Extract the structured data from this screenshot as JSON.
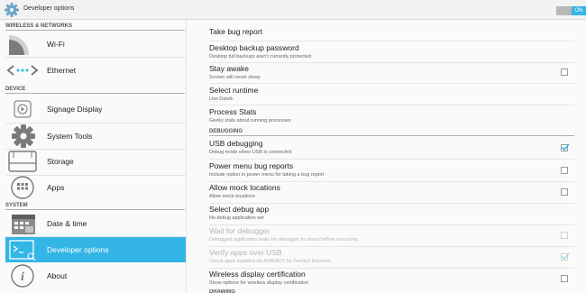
{
  "titlebar": {
    "title": "Developer options",
    "toggle_label": "ON",
    "toggle_on": true,
    "gear_icon": "gear-icon"
  },
  "sidebar": {
    "sections": [
      "WIRELESS & NETWORKS",
      "DEVICE",
      "SYSTEM"
    ],
    "items": [
      {
        "label": "Wi-Fi",
        "icon": "wifi-icon"
      },
      {
        "label": "Ethernet",
        "icon": "ethernet-icon"
      },
      {
        "label": "Signage Display",
        "icon": "signage-display-icon"
      },
      {
        "label": "System Tools",
        "icon": "gear-icon"
      },
      {
        "label": "Storage",
        "icon": "storage-icon"
      },
      {
        "label": "Apps",
        "icon": "apps-icon"
      },
      {
        "label": "Date & time",
        "icon": "calendar-icon"
      },
      {
        "label": "Developer options",
        "icon": "terminal-icon",
        "selected": true
      },
      {
        "label": "About",
        "icon": "info-icon"
      }
    ]
  },
  "main": {
    "sections": [
      "DEBUGGING",
      "DRAWING"
    ],
    "prefs": [
      {
        "title": "Take bug report",
        "summary": ""
      },
      {
        "title": "Desktop backup password",
        "summary": "Desktop full backups aren't currently protected"
      },
      {
        "title": "Stay awake",
        "summary": "Screen will never sleep",
        "checked": false
      },
      {
        "title": "Select runtime",
        "summary": "Use Dalvik"
      },
      {
        "title": "Process Stats",
        "summary": "Geeky stats about running processes"
      },
      {
        "title": "USB debugging",
        "summary": "Debug mode when USB is connected",
        "checked": true
      },
      {
        "title": "Power menu bug reports",
        "summary": "Include option in power menu for taking a bug report",
        "checked": false
      },
      {
        "title": "Allow mock locations",
        "summary": "Allow mock locations",
        "checked": false
      },
      {
        "title": "Select debug app",
        "summary": "No debug application set"
      },
      {
        "title": "Wait for debugger",
        "summary": "Debugged application waits for debugger to attach before executing",
        "checked": false,
        "disabled": true
      },
      {
        "title": "Verify apps over USB",
        "summary": "Check apps installed via ADB/ADT for harmful behavior.",
        "checked": true,
        "disabled": true
      },
      {
        "title": "Wireless display certification",
        "summary": "Show options for wireless display certification",
        "checked": false
      }
    ]
  },
  "colors": {
    "accent": "#33b5e5",
    "background": "#fafafa"
  }
}
